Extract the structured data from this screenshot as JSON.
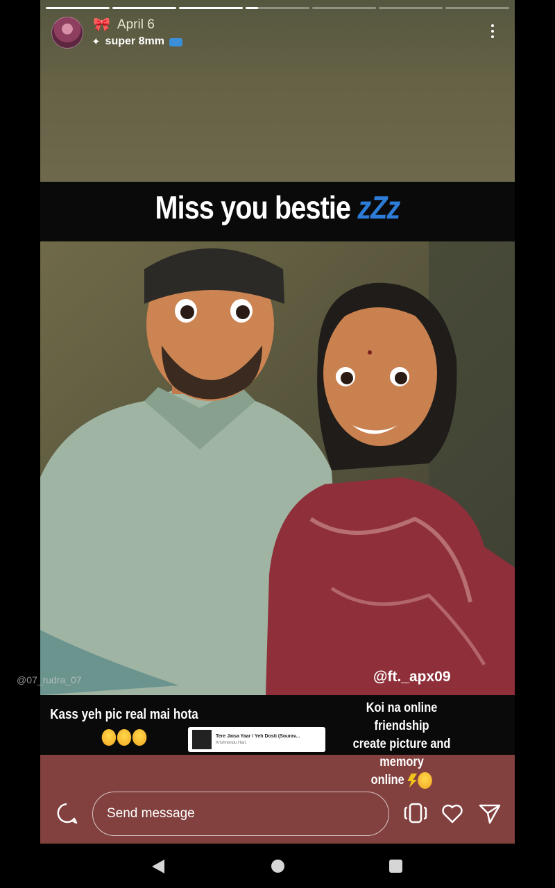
{
  "header": {
    "progress_segments": [
      1,
      1,
      1,
      0.2,
      0,
      0,
      0
    ],
    "bow_icon": "bow-icon",
    "date": "April 6",
    "audio_label": "super 8mm",
    "sparkle_icon": "sparkle-icon"
  },
  "story": {
    "headline": "Miss you bestie",
    "headline_suffix": "zZz",
    "watermark_left": "@07_rudra_07",
    "watermark_right": "@ft._apx09",
    "caption_left": "Kass yeh pic real mai hota",
    "caption_right_lines": [
      "Koi na online friendship",
      "create picture and memory",
      "online"
    ],
    "music": {
      "title": "Tere Jaisa Yaar / Yeh Dosti (Sourav...",
      "artist": "Krishnendu Hari,"
    }
  },
  "footer": {
    "message_placeholder": "Send message",
    "icons": [
      "message-icon",
      "rings-icon",
      "heart-icon",
      "share-icon"
    ],
    "accent_color": "#82413f"
  }
}
